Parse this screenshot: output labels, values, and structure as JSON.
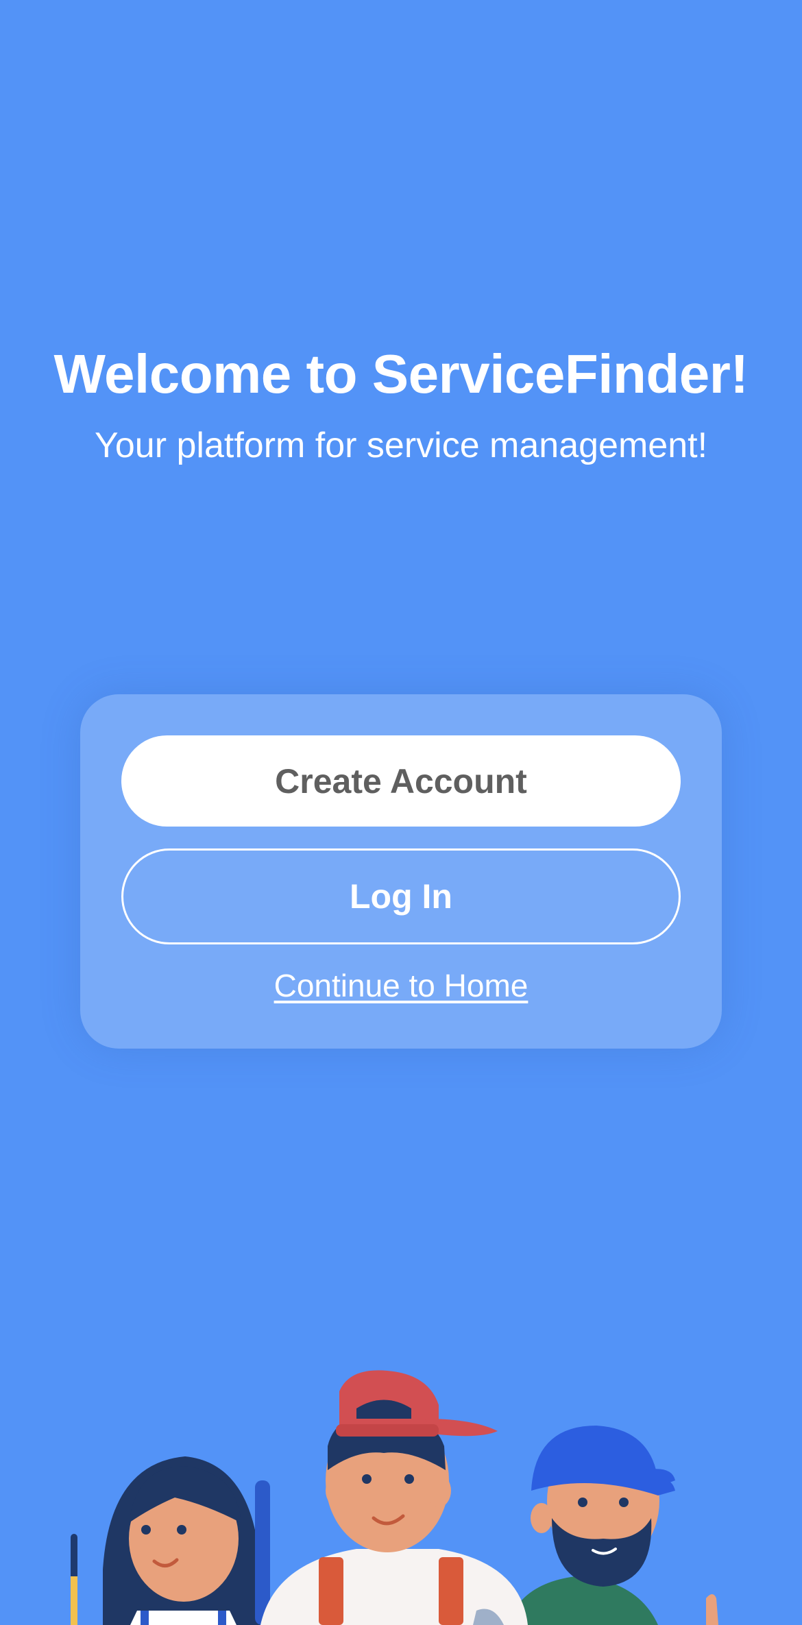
{
  "welcome": {
    "title": "Welcome to ServiceFinder!",
    "subtitle": "Your platform for service management!"
  },
  "actions": {
    "create_account_label": "Create Account",
    "login_label": "Log In",
    "continue_label": "Continue to Home"
  },
  "colors": {
    "background": "#5393f7",
    "card": "rgba(255,255,255,0.22)",
    "primary_button": "#ffffff",
    "primary_button_text": "#5f5f5f"
  },
  "illustration": {
    "icon": "service-workers-illustration"
  }
}
